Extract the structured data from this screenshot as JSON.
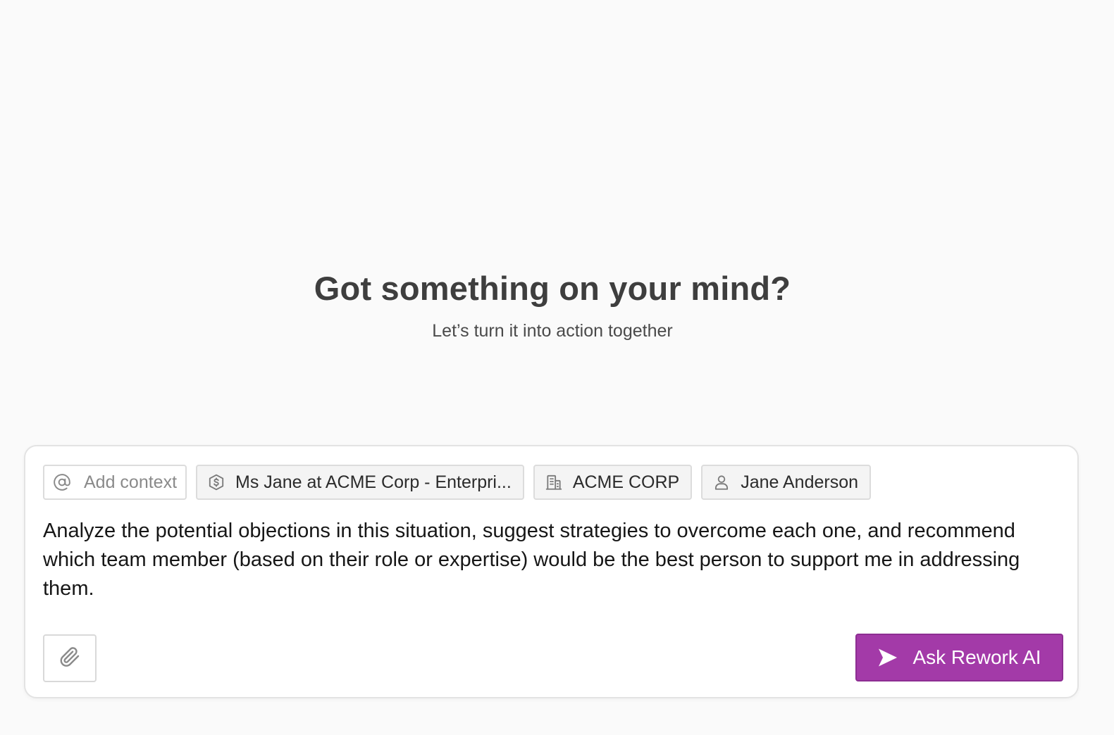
{
  "hero": {
    "title": "Got something on your mind?",
    "subtitle": "Let’s turn it into action together"
  },
  "context_chips": {
    "add_context": {
      "icon": "at-sign-icon",
      "label": "Add context"
    },
    "items": [
      {
        "icon": "deal-dollar-icon",
        "label": "Ms Jane at ACME Corp - Enterpri..."
      },
      {
        "icon": "building-icon",
        "label": "ACME CORP"
      },
      {
        "icon": "user-icon",
        "label": "Jane Anderson"
      }
    ]
  },
  "prompt": {
    "text": "Analyze the potential objections in this situation, suggest strategies to overcome each one, and recommend which team member (based on their role or expertise) would be the best person to support me in addressing them."
  },
  "actions": {
    "attach_icon": "paperclip-icon",
    "ask_label": "Ask Rework AI",
    "ask_icon": "send-icon"
  },
  "colors": {
    "accent": "#a33aa8",
    "background": "#fafafa",
    "chip_background": "#f4f4f4"
  }
}
